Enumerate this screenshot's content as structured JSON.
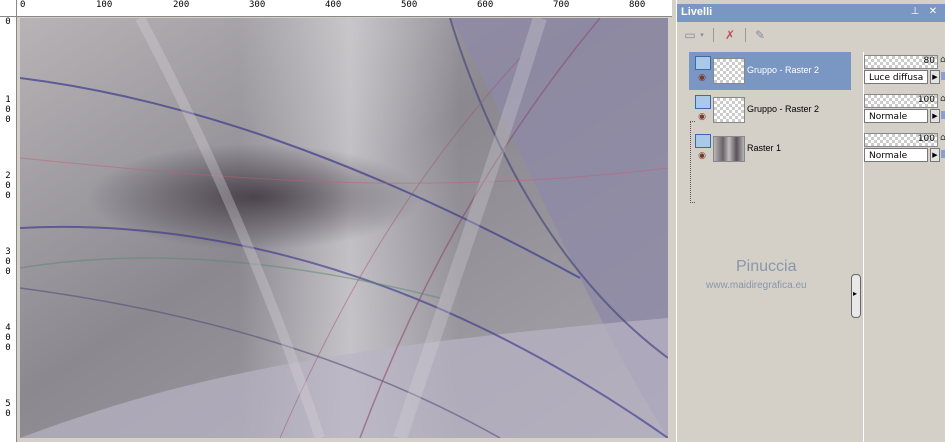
{
  "ruler": {
    "top_labels": [
      "0",
      "100",
      "200",
      "300",
      "400",
      "500",
      "600",
      "700",
      "800"
    ],
    "left_labels": [
      "0",
      "1",
      "0",
      "0",
      "2",
      "0",
      "0",
      "3",
      "0",
      "0",
      "4",
      "0",
      "0",
      "5",
      "0"
    ]
  },
  "layers_panel": {
    "title": "Livelli",
    "pin_icon": "pin-icon",
    "close_icon": "close-icon",
    "layers": [
      {
        "name": "Gruppo - Raster 2",
        "opacity": "80",
        "blend_mode": "Luce diffusa",
        "selected": true
      },
      {
        "name": "Gruppo - Raster 2",
        "opacity": "100",
        "blend_mode": "Normale",
        "selected": false
      },
      {
        "name": "Raster 1",
        "opacity": "100",
        "blend_mode": "Normale",
        "selected": false
      }
    ]
  },
  "watermark": {
    "name": "Pinuccia",
    "url": "www.maidiregrafica.eu"
  },
  "colors": {
    "selection": "#7a96c2",
    "panel_bg": "#d4d0c8"
  }
}
